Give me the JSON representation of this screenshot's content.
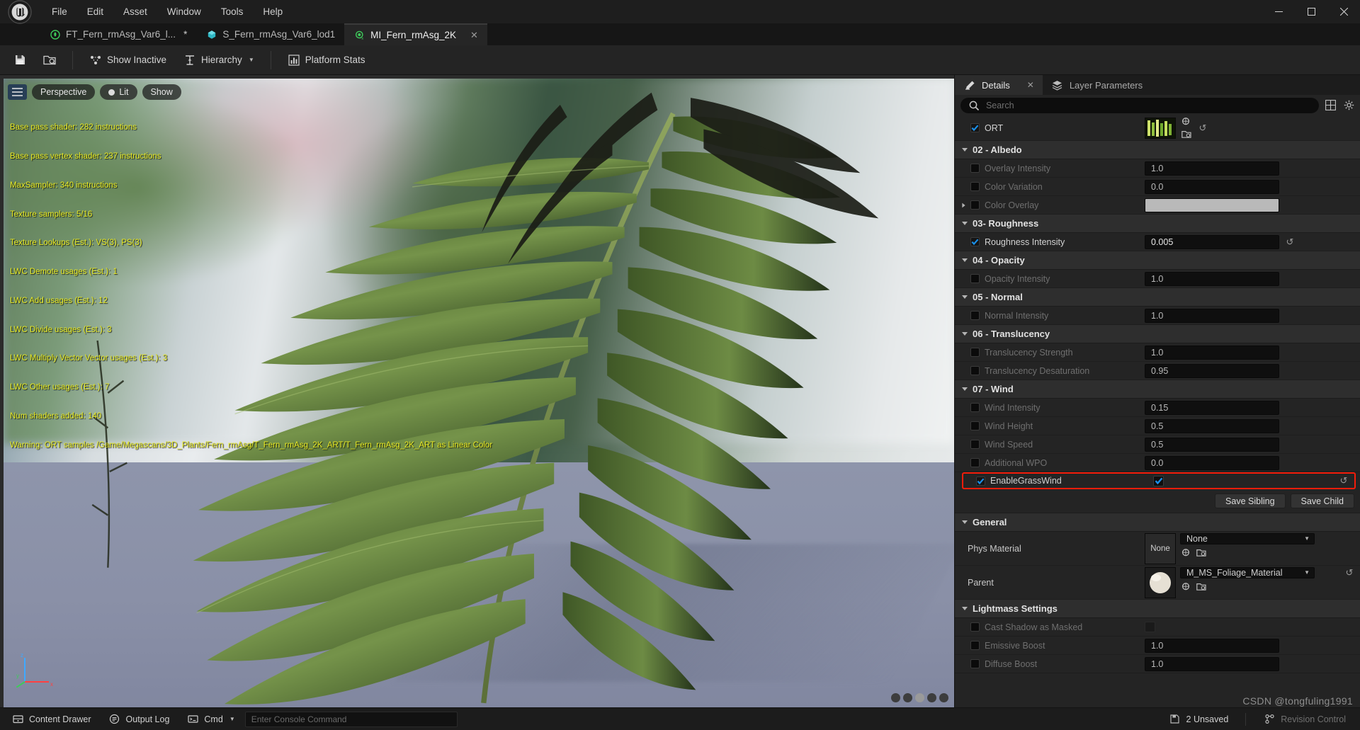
{
  "window": {
    "app": "Unreal Editor",
    "minimize": "—",
    "maximize": "☐",
    "close": "✕"
  },
  "menu": {
    "items": [
      "File",
      "Edit",
      "Asset",
      "Window",
      "Tools",
      "Help"
    ]
  },
  "tabs": [
    {
      "label": "FT_Fern_rmAsg_Var6_l...",
      "modified": "*",
      "icon": "foliage-type-icon",
      "active": false
    },
    {
      "label": "S_Fern_rmAsg_Var6_lod1",
      "modified": "",
      "icon": "static-mesh-icon",
      "active": false
    },
    {
      "label": "MI_Fern_rmAsg_2K",
      "modified": "",
      "icon": "material-instance-icon",
      "active": true,
      "close": "✕"
    }
  ],
  "toolbar": {
    "save_tooltip": "Save",
    "browse_tooltip": "Browse",
    "show_inactive": "Show Inactive",
    "hierarchy": "Hierarchy",
    "platform_stats": "Platform Stats"
  },
  "viewport": {
    "menu_icon": "viewport-menu-icon",
    "perspective": "Perspective",
    "lit": "Lit",
    "show": "Show",
    "axis": {
      "x": "x",
      "y": "y",
      "z": "z"
    },
    "stats": [
      "Base pass shader: 282 instructions",
      "Base pass vertex shader: 237 instructions",
      "MaxSampler: 340 instructions",
      "Texture samplers: 5/16",
      "Texture Lookups (Est.): VS(3), PS(3)",
      "LWC Demote usages (Est.): 1",
      "LWC Add usages (Est.): 12",
      "LWC Divide usages (Est.): 3",
      "LWC Multiply Vector Vector usages (Est.): 3",
      "LWC Other usages (Est.): 7",
      "Num shaders added: 140",
      "Warning: ORT samples /Game/Megascans/3D_Plants/Fern_rmAsg/T_Fern_rmAsg_2K_ART/T_Fern_rmAsg_2K_ART as Linear Color"
    ]
  },
  "details": {
    "tab_details": "Details",
    "tab_details_close": "✕",
    "tab_layer_params": "Layer Parameters",
    "search": {
      "placeholder": "Search",
      "value": ""
    },
    "grid_icon": "grid-view-icon",
    "settings_icon": "gear-icon",
    "ort": {
      "label": "ORT",
      "checked": true,
      "thumbnail": "texture-thumbnail"
    },
    "sections": [
      {
        "title": "02 - Albedo",
        "expanded": true,
        "rows": [
          {
            "label": "Overlay Intensity",
            "checked": false,
            "type": "number",
            "value": "1.0",
            "revert": false
          },
          {
            "label": "Color Variation",
            "checked": false,
            "type": "number",
            "value": "0.0",
            "revert": false
          },
          {
            "label": "Color Overlay",
            "checked": false,
            "type": "color",
            "value": "#b9b9b9",
            "expander": true,
            "revert": false
          }
        ]
      },
      {
        "title": "03- Roughness",
        "expanded": true,
        "rows": [
          {
            "label": "Roughness Intensity",
            "checked": true,
            "type": "number",
            "value": "0.005",
            "revert": true
          }
        ]
      },
      {
        "title": "04 - Opacity",
        "expanded": true,
        "rows": [
          {
            "label": "Opacity Intensity",
            "checked": false,
            "type": "number",
            "value": "1.0",
            "revert": false
          }
        ]
      },
      {
        "title": "05 - Normal",
        "expanded": true,
        "rows": [
          {
            "label": "Normal Intensity",
            "checked": false,
            "type": "number",
            "value": "1.0",
            "revert": false
          }
        ]
      },
      {
        "title": "06 - Translucency",
        "expanded": true,
        "rows": [
          {
            "label": "Translucency Strength",
            "checked": false,
            "type": "number",
            "value": "1.0",
            "revert": false
          },
          {
            "label": "Translucency Desaturation",
            "checked": false,
            "type": "number",
            "value": "0.95",
            "revert": false
          }
        ]
      },
      {
        "title": "07 - Wind",
        "expanded": true,
        "rows": [
          {
            "label": "Wind Intensity",
            "checked": false,
            "type": "number",
            "value": "0.15",
            "revert": false
          },
          {
            "label": "Wind Height",
            "checked": false,
            "type": "number",
            "value": "0.5",
            "revert": false
          },
          {
            "label": "Wind Speed",
            "checked": false,
            "type": "number",
            "value": "0.5",
            "revert": false
          },
          {
            "label": "Additional WPO",
            "checked": false,
            "type": "number",
            "value": "0.0",
            "revert": false
          },
          {
            "label": "EnableGrassWind",
            "checked": true,
            "type": "bool",
            "value": true,
            "revert": true,
            "highlighted": true
          }
        ]
      }
    ],
    "save_sibling": "Save Sibling",
    "save_child": "Save Child",
    "general": {
      "title": "General",
      "expanded": true,
      "phys_material": {
        "label": "Phys Material",
        "thumb": "None",
        "value": "None"
      },
      "parent": {
        "label": "Parent",
        "value": "M_MS_Foliage_Material",
        "revert": true
      }
    },
    "lightmass": {
      "title": "Lightmass Settings",
      "expanded": true,
      "rows": [
        {
          "label": "Cast Shadow as Masked",
          "checked": false,
          "type": "bool",
          "value": false
        },
        {
          "label": "Emissive Boost",
          "checked": false,
          "type": "number",
          "value": "1.0"
        },
        {
          "label": "Diffuse Boost",
          "checked": false,
          "type": "number",
          "value": "1.0"
        }
      ]
    }
  },
  "statusbar": {
    "content_drawer": "Content Drawer",
    "output_log": "Output Log",
    "cmd_label": "Cmd",
    "console_placeholder": "Enter Console Command",
    "unsaved": "2 Unsaved",
    "revision": "Revision Control"
  },
  "watermark": {
    "line1": "CSDN @tongfuling1991"
  },
  "colors": {
    "accent_blue": "#0f8cf0",
    "highlight_red": "#f41d0a",
    "stat_yellow": "#e8ea24",
    "panel_bg": "#242424"
  }
}
